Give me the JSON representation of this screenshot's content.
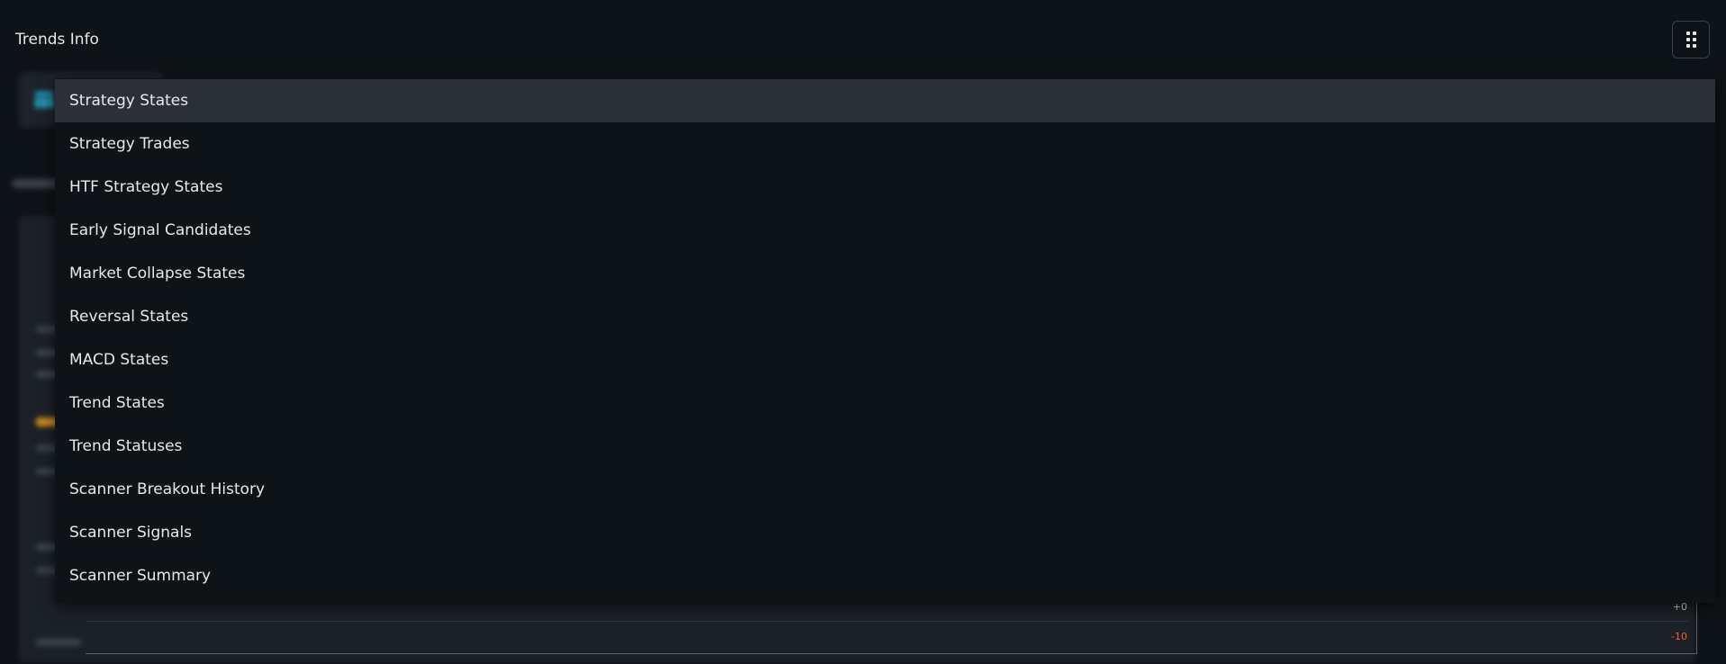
{
  "header": {
    "title": "Trends Info"
  },
  "menu": {
    "items": [
      {
        "label": "Strategy States",
        "active": true
      },
      {
        "label": "Strategy Trades",
        "active": false
      },
      {
        "label": "HTF Strategy States",
        "active": false
      },
      {
        "label": "Early Signal Candidates",
        "active": false
      },
      {
        "label": "Market Collapse States",
        "active": false
      },
      {
        "label": "Reversal States",
        "active": false
      },
      {
        "label": "MACD States",
        "active": false
      },
      {
        "label": "Trend States",
        "active": false
      },
      {
        "label": "Trend Statuses",
        "active": false
      },
      {
        "label": "Scanner Breakout History",
        "active": false
      },
      {
        "label": "Scanner Signals",
        "active": false
      },
      {
        "label": "Scanner Summary",
        "active": false
      }
    ]
  },
  "background_chart": {
    "tick_labels": [
      "+0",
      "-10"
    ]
  },
  "colors": {
    "accent": "#1fb6d8",
    "negative": "#ff5a3c",
    "active_item_bg": "#2a3035"
  },
  "icons": {
    "menu_button": "dots-grid-icon",
    "card": "table-icon"
  }
}
